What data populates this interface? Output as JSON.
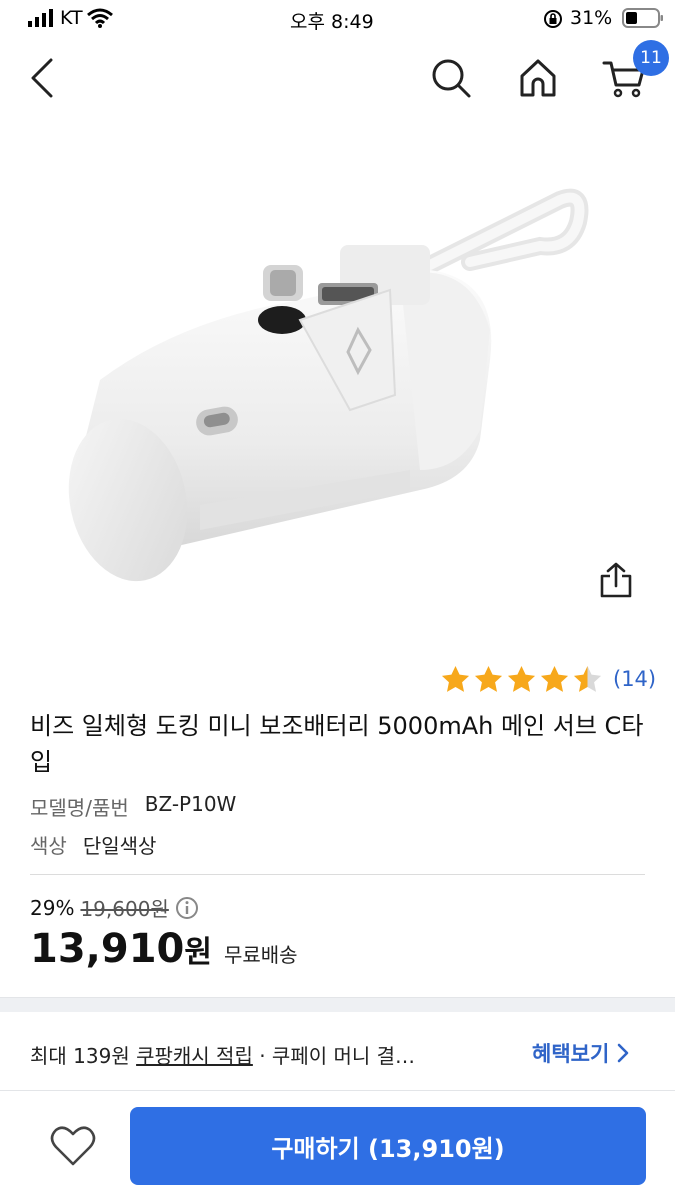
{
  "status_bar": {
    "carrier": "KT",
    "time": "오후 8:49",
    "battery": "31%"
  },
  "nav": {
    "cart_badge": "11"
  },
  "product": {
    "rating_count": "(14)",
    "rating_value": 4.5,
    "title": "비즈 일체형 도킹 미니 보조배터리 5000mAh 메인 서브 C타입",
    "model_label": "모델명/품번",
    "model_value": "BZ-P10W",
    "color_label": "색상",
    "color_value": "단일색상",
    "discount_rate": "29%",
    "original_price": "19,600원",
    "sale_price": "13,910",
    "currency": "원",
    "shipping": "무료배송"
  },
  "benefit": {
    "prefix": "최대 139원 ",
    "link_text": "쿠팡캐시 적립",
    "suffix": " · 쿠페이 머니 결…",
    "action_label": "혜택보기"
  },
  "bottom": {
    "buy_label": "구매하기 (13,910원)"
  },
  "colors": {
    "accent": "#2f6fe4",
    "link": "#2f64c8",
    "star": "#f7a81b"
  }
}
